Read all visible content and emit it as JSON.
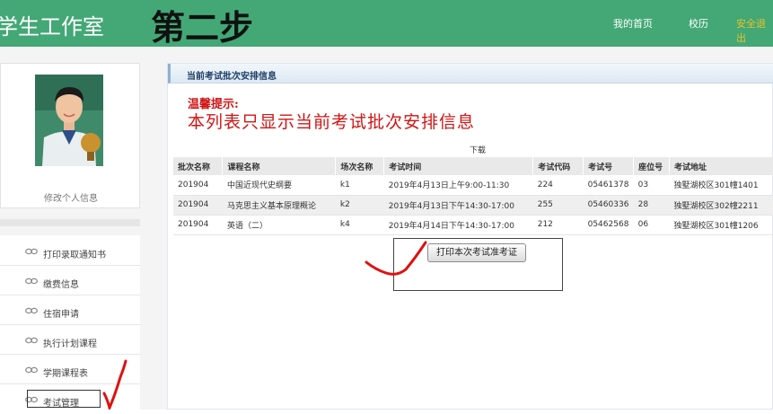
{
  "header": {
    "site_title": "学生工作室",
    "step_title": "第二步",
    "nav": {
      "home": "我的首页",
      "calendar": "校历",
      "logout": "安全退出"
    }
  },
  "profile": {
    "edit_label": "修改个人信息"
  },
  "sidebar": {
    "items": [
      {
        "label": "打印录取通知书"
      },
      {
        "label": "缴费信息"
      },
      {
        "label": "住宿申请"
      },
      {
        "label": "执行计划课程"
      },
      {
        "label": "学期课程表"
      },
      {
        "label": "考试管理"
      }
    ]
  },
  "main": {
    "section_title": "当前考试批次安排信息",
    "tip_label": "温馨提示:",
    "tip_text": "本列表只显示当前考试批次安排信息",
    "download_label": "下载",
    "columns": [
      "批次名称",
      "课程名称",
      "场次名称",
      "考试时间",
      "考试代码",
      "考试号",
      "座位号",
      "考试地址"
    ],
    "rows": [
      [
        "201904",
        "中国近现代史纲要",
        "k1",
        "2019年4月13日上午9:00-11:30",
        "224",
        "05461378",
        "03",
        "独墅湖校区301幢1401"
      ],
      [
        "201904",
        "马克思主义基本原理概论",
        "k2",
        "2019年4月13日下午14:30-17:00",
        "255",
        "05460336",
        "28",
        "独墅湖校区302幢2211"
      ],
      [
        "201904",
        "英语（二）",
        "k4",
        "2019年4月14日下午14:30-17:00",
        "212",
        "05462568",
        "06",
        "独墅湖校区301幢1206"
      ]
    ],
    "print_button": "打印本次考试准考证"
  },
  "colors": {
    "header_green": "#43a876",
    "tip_red": "#d11414",
    "annotation_red": "#e01010"
  }
}
